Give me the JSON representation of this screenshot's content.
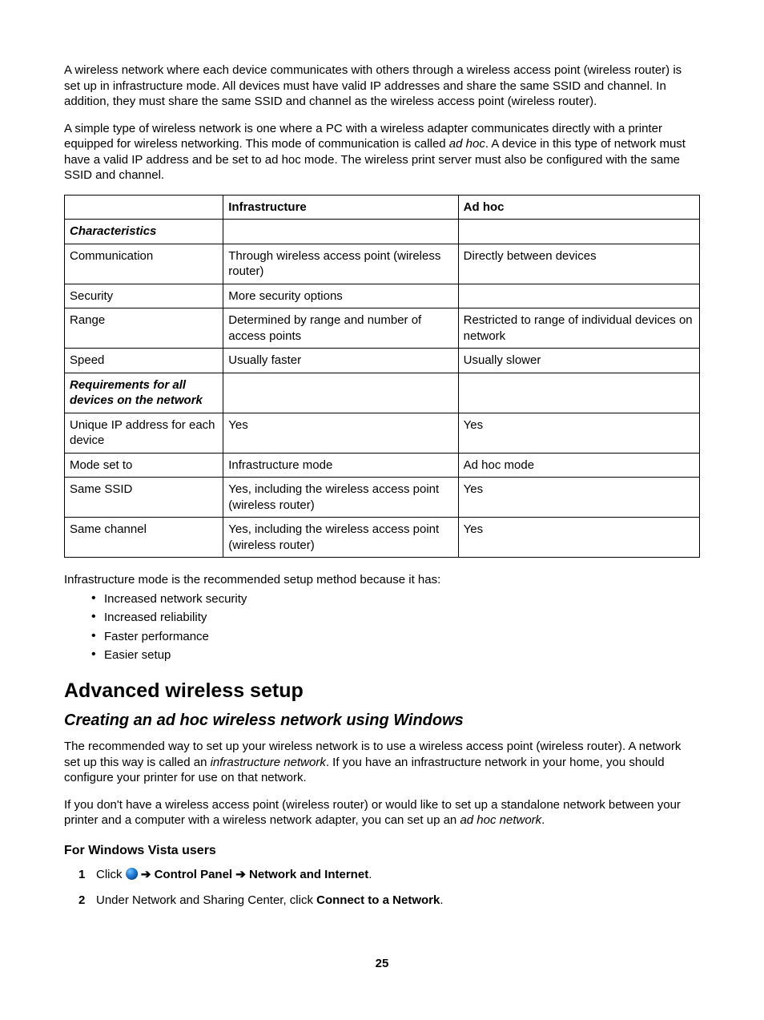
{
  "intro": {
    "p1": "A wireless network where each device communicates with others through a wireless access point (wireless router) is set up in infrastructure mode. All devices must have valid IP addresses and share the same SSID and channel. In addition, they must share the same SSID and channel as the wireless access point (wireless router).",
    "p2a": "A simple type of wireless network is one where a PC with a wireless adapter communicates directly with a printer equipped for wireless networking. This mode of communication is called ",
    "p2i": "ad hoc",
    "p2b": ". A device in this type of network must have a valid IP address and be set to ad hoc mode. The wireless print server must also be configured with the same SSID and channel."
  },
  "table": {
    "headers": {
      "c1": "",
      "c2": "Infrastructure",
      "c3": "Ad hoc"
    },
    "section1": "Characteristics",
    "rows1": [
      {
        "a": "Communication",
        "b": "Through wireless access point (wireless router)",
        "c": "Directly between devices"
      },
      {
        "a": "Security",
        "b": "More security options",
        "c": ""
      },
      {
        "a": "Range",
        "b": "Determined by range and number of access points",
        "c": "Restricted to range of individual devices on network"
      },
      {
        "a": "Speed",
        "b": "Usually faster",
        "c": "Usually slower"
      }
    ],
    "section2": "Requirements for all devices on the network",
    "rows2": [
      {
        "a": "Unique IP address for each device",
        "b": "Yes",
        "c": "Yes"
      },
      {
        "a": "Mode set to",
        "b": "Infrastructure mode",
        "c": "Ad hoc mode"
      },
      {
        "a": "Same SSID",
        "b": "Yes, including the wireless access point (wireless router)",
        "c": "Yes"
      },
      {
        "a": "Same channel",
        "b": "Yes, including the wireless access point (wireless router)",
        "c": "Yes"
      }
    ]
  },
  "after_table": {
    "lead": "Infrastructure mode is the recommended setup method because it has:",
    "bullets": [
      "Increased network security",
      "Increased reliability",
      "Faster performance",
      "Easier setup"
    ]
  },
  "advanced": {
    "h1": "Advanced wireless setup",
    "h2": "Creating an ad hoc wireless network using Windows",
    "p1a": "The recommended way to set up your wireless network is to use a wireless access point (wireless router). A network set up this way is called an ",
    "p1i": "infrastructure network",
    "p1b": ". If you have an infrastructure network in your home, you should configure your printer for use on that network.",
    "p2a": "If you don't have a wireless access point (wireless router) or would like to set up a standalone network between your printer and a computer with a wireless network adapter, you can set up an ",
    "p2i": "ad hoc network",
    "p2b": ".",
    "h3": "For Windows Vista users",
    "steps": {
      "s1": {
        "num": "1",
        "click": "Click ",
        "arrow1": " ➔ ",
        "cp": "Control Panel",
        "arrow2": " ➔ ",
        "ni": "Network and Internet",
        "dot": "."
      },
      "s2": {
        "num": "2",
        "a": "Under Network and Sharing Center, click ",
        "b": "Connect to a Network",
        "c": "."
      }
    }
  },
  "page_number": "25"
}
